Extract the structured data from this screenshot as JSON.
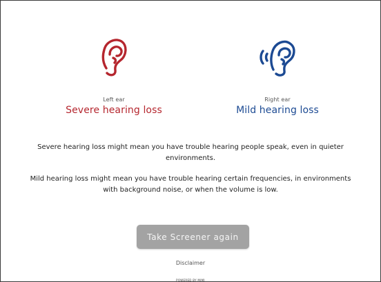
{
  "results": {
    "left": {
      "label": "Left ear",
      "level": "Severe hearing loss",
      "color": "#b5262e"
    },
    "right": {
      "label": "Right ear",
      "level": "Mild hearing loss",
      "color": "#1c4a93"
    }
  },
  "descriptions": [
    "Severe hearing loss might mean you have trouble hearing people speak, even in quieter environments.",
    "Mild hearing loss might mean you have trouble hearing certain frequencies, in environments with background noise, or when the volume is low."
  ],
  "actions": {
    "retake_label": "Take Screener again",
    "disclaimer_label": "Disclaimer"
  },
  "footer": {
    "powered_by": "POWERED BY MIMI"
  },
  "icons": {
    "left_ear": "ear-icon",
    "right_ear": "ear-with-sound-waves-icon"
  }
}
